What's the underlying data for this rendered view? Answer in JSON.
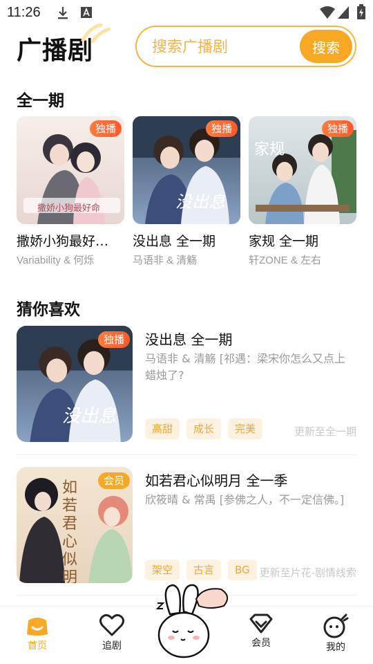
{
  "status_bar": {
    "time": "11:26"
  },
  "header": {
    "title": "广播剧"
  },
  "search": {
    "placeholder": "搜索广播剧",
    "button_label": "搜索"
  },
  "section_full": {
    "title": "全一期",
    "items": [
      {
        "title": "撒娇小狗最好…",
        "subtitle": "Variability & 何烁",
        "badge": "独播",
        "cover_text": "撒娇小狗最好命"
      },
      {
        "title": "没出息 全一期",
        "subtitle": "马语非 & 清觞",
        "badge": "独播",
        "cover_text": "没出息"
      },
      {
        "title": "家规 全一期",
        "subtitle": "轩ZONE & 左右",
        "badge": "独播",
        "cover_text": "家规"
      }
    ]
  },
  "section_guess": {
    "title": "猜你喜欢",
    "items": [
      {
        "title": "没出息 全一期",
        "description": "马语非 & 清觞 [祁遇：梁宋你怎么又点上蜡烛了?",
        "badge": "独播",
        "tags": [
          "高甜",
          "成长",
          "完美"
        ],
        "update": "更新至全一期",
        "cover_text": "没出息"
      },
      {
        "title": "如若君心似明月 全一季",
        "description": "欣筱晴 & 常禹 [参佛之人，不一定信佛。]",
        "badge": "会员",
        "tags": [
          "架空",
          "古言",
          "BG"
        ],
        "update": "更新至片花-剧情线索",
        "cover_text": "如若君心似明月"
      }
    ]
  },
  "bottom_nav": {
    "items": [
      {
        "label": "首页",
        "icon": "home-icon",
        "active": true
      },
      {
        "label": "追剧",
        "icon": "heart-icon"
      },
      {
        "label": "会员",
        "icon": "vip-diamond-icon"
      },
      {
        "label": "我的",
        "icon": "profile-icon"
      }
    ],
    "mascot": "bunny-mascot-icon"
  },
  "colors": {
    "accent": "#f7a925",
    "badge": "#ff6a33",
    "tag_bg": "#fdf1df",
    "tag_text": "#f0a63a"
  }
}
